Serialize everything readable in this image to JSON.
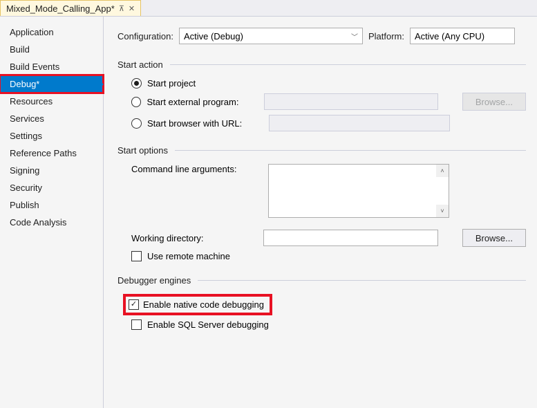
{
  "tab": {
    "title": "Mixed_Mode_Calling_App*"
  },
  "sidebar": {
    "items": [
      {
        "label": "Application"
      },
      {
        "label": "Build"
      },
      {
        "label": "Build Events"
      },
      {
        "label": "Debug*",
        "selected": true,
        "highlighted": true
      },
      {
        "label": "Resources"
      },
      {
        "label": "Services"
      },
      {
        "label": "Settings"
      },
      {
        "label": "Reference Paths"
      },
      {
        "label": "Signing"
      },
      {
        "label": "Security"
      },
      {
        "label": "Publish"
      },
      {
        "label": "Code Analysis"
      }
    ]
  },
  "top": {
    "config_label": "Configuration:",
    "config_value": "Active (Debug)",
    "platform_label": "Platform:",
    "platform_value": "Active (Any CPU)"
  },
  "sections": {
    "start_action": {
      "title": "Start action",
      "start_project": "Start project",
      "start_external": "Start external program:",
      "start_browser": "Start browser with URL:",
      "browse": "Browse..."
    },
    "start_options": {
      "title": "Start options",
      "cmdline": "Command line arguments:",
      "workdir": "Working directory:",
      "remote": "Use remote machine",
      "browse": "Browse..."
    },
    "debugger": {
      "title": "Debugger engines",
      "native": "Enable native code debugging",
      "sql": "Enable SQL Server debugging"
    }
  }
}
